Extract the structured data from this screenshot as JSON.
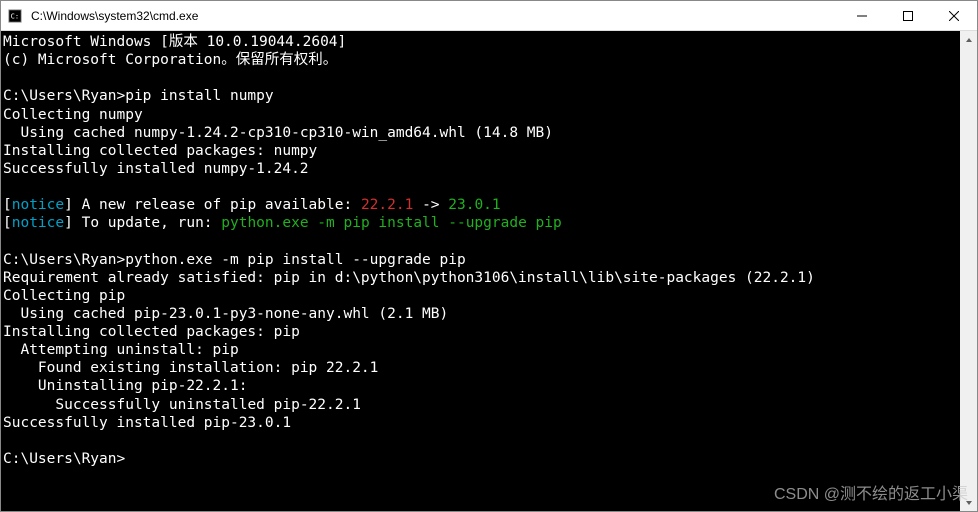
{
  "title": "C:\\Windows\\system32\\cmd.exe",
  "header": {
    "version_line": "Microsoft Windows [版本 10.0.19044.2604]",
    "copyright_line": "(c) Microsoft Corporation。保留所有权利。"
  },
  "block1": {
    "prompt": "C:\\Users\\Ryan>",
    "command": "pip install numpy",
    "line_collecting": "Collecting numpy",
    "line_cached": "  Using cached numpy-1.24.2-cp310-cp310-win_amd64.whl (14.8 MB)",
    "line_installing": "Installing collected packages: numpy",
    "line_success": "Successfully installed numpy-1.24.2"
  },
  "notice1": {
    "open_bracket": "[",
    "notice_word": "notice",
    "close_bracket": "]",
    "text": " A new release of pip available: ",
    "old_ver": "22.2.1",
    "arrow": " -> ",
    "new_ver": "23.0.1"
  },
  "notice2": {
    "open_bracket": "[",
    "notice_word": "notice",
    "close_bracket": "]",
    "text": " To update, run: ",
    "cmd": "python.exe -m pip install --upgrade pip"
  },
  "block2": {
    "prompt": "C:\\Users\\Ryan>",
    "command": "python.exe -m pip install --upgrade pip",
    "line_req": "Requirement already satisfied: pip in d:\\python\\python3106\\install\\lib\\site-packages (22.2.1)",
    "line_collecting": "Collecting pip",
    "line_cached": "  Using cached pip-23.0.1-py3-none-any.whl (2.1 MB)",
    "line_installing": "Installing collected packages: pip",
    "line_attempt": "  Attempting uninstall: pip",
    "line_found": "    Found existing installation: pip 22.2.1",
    "line_uninst": "    Uninstalling pip-22.2.1:",
    "line_uninst_ok": "      Successfully uninstalled pip-22.2.1",
    "line_success": "Successfully installed pip-23.0.1"
  },
  "final_prompt": "C:\\Users\\Ryan>",
  "watermark": "CSDN @测不绘的返工小渠"
}
